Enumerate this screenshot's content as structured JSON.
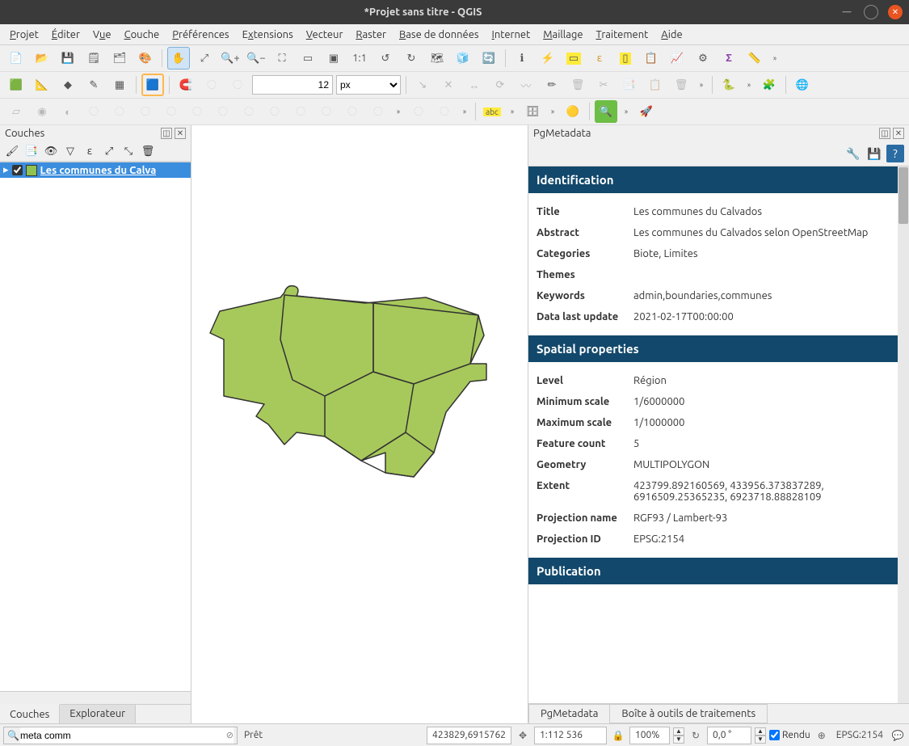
{
  "window": {
    "title": "*Projet sans titre - QGIS"
  },
  "menubar": {
    "items": [
      {
        "label": "Projet",
        "u": "P"
      },
      {
        "label": "Éditer",
        "u": "É"
      },
      {
        "label": "Vue",
        "u": "V"
      },
      {
        "label": "Couche",
        "u": "C"
      },
      {
        "label": "Préférences",
        "u": "P"
      },
      {
        "label": "Extensions",
        "u": "E"
      },
      {
        "label": "Vecteur",
        "u": "V"
      },
      {
        "label": "Raster",
        "u": "R"
      },
      {
        "label": "Base de données",
        "u": "B"
      },
      {
        "label": "Internet",
        "u": "I"
      },
      {
        "label": "Maillage",
        "u": "M"
      },
      {
        "label": "Traitement",
        "u": "T"
      },
      {
        "label": "Aide",
        "u": "A"
      }
    ]
  },
  "toolbar1": {
    "font_size": "12",
    "font_unit": "px"
  },
  "layers_panel": {
    "title": "Couches",
    "layer_label": "Les communes du Calva",
    "layer_checked": true,
    "tabs": {
      "active": "Couches",
      "inactive": "Explorateur"
    }
  },
  "pgmetadata_panel": {
    "title": "PgMetadata",
    "sections": {
      "identification": {
        "header": "Identification",
        "rows": [
          {
            "key": "Title",
            "val": "Les communes du Calvados"
          },
          {
            "key": "Abstract",
            "val": "Les communes du Calvados selon OpenStreetMap"
          },
          {
            "key": "Categories",
            "val": "Biote, Limites"
          },
          {
            "key": "Themes",
            "val": ""
          },
          {
            "key": "Keywords",
            "val": "admin,boundaries,communes"
          },
          {
            "key": "Data last update",
            "val": "2021-02-17T00:00:00"
          }
        ]
      },
      "spatial": {
        "header": "Spatial properties",
        "rows": [
          {
            "key": "Level",
            "val": "Région"
          },
          {
            "key": "Minimum scale",
            "val": "1/6000000"
          },
          {
            "key": "Maximum scale",
            "val": "1/1000000"
          },
          {
            "key": "Feature count",
            "val": "5"
          },
          {
            "key": "Geometry",
            "val": "MULTIPOLYGON"
          },
          {
            "key": "Extent",
            "val": "423799.892160569, 433956.373837289, 6916509.25365235, 6923718.88828109"
          },
          {
            "key": "Projection name",
            "val": "RGF93 / Lambert-93"
          },
          {
            "key": "Projection ID",
            "val": "EPSG:2154"
          }
        ]
      },
      "publication": {
        "header": "Publication"
      }
    },
    "tabs": {
      "active": "PgMetadata",
      "inactive": "Boîte à outils de traitements"
    }
  },
  "statusbar": {
    "search": "meta comm",
    "ready": "Prêt",
    "coords": "423829,6915762",
    "scale_label": "1:112 536",
    "mag": "100%",
    "rotation": "0,0 °",
    "render": "Rendu",
    "crs": "EPSG:2154"
  }
}
